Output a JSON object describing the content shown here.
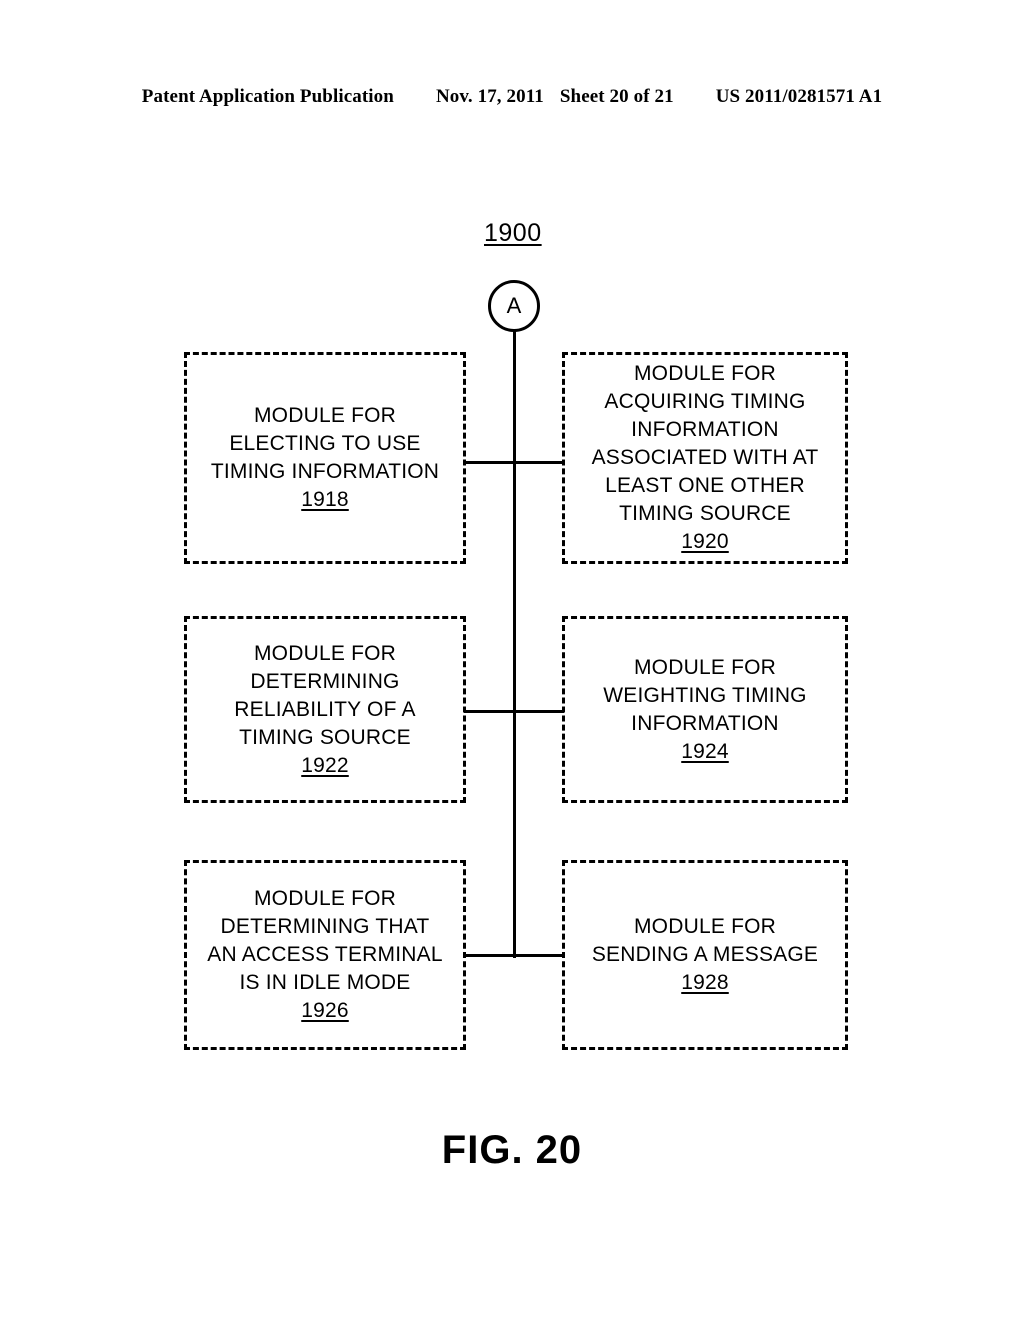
{
  "header": {
    "publication": "Patent Application Publication",
    "date": "Nov. 17, 2011",
    "sheet": "Sheet 20 of 21",
    "document_number": "US 2011/0281571 A1"
  },
  "figure": {
    "reference_number": "1900",
    "connector_node_label": "A",
    "caption": "FIG. 20",
    "line_color": "#000000",
    "background_color": "#ffffff"
  },
  "modules": [
    {
      "id": "1918",
      "side": "left",
      "row": 1,
      "text": "MODULE FOR\nELECTING TO USE\nTIMING INFORMATION",
      "ref": "1918"
    },
    {
      "id": "1920",
      "side": "right",
      "row": 1,
      "text": "MODULE FOR\nACQUIRING TIMING\nINFORMATION\nASSOCIATED WITH AT\nLEAST ONE OTHER\nTIMING SOURCE",
      "ref": "1920"
    },
    {
      "id": "1922",
      "side": "left",
      "row": 2,
      "text": "MODULE FOR\nDETERMINING\nRELIABILITY OF A\nTIMING SOURCE",
      "ref": "1922"
    },
    {
      "id": "1924",
      "side": "right",
      "row": 2,
      "text": "MODULE FOR\nWEIGHTING TIMING\nINFORMATION",
      "ref": "1924"
    },
    {
      "id": "1926",
      "side": "left",
      "row": 3,
      "text": "MODULE FOR\nDETERMINING  THAT\nAN ACCESS TERMINAL\nIS IN IDLE MODE",
      "ref": "1926"
    },
    {
      "id": "1928",
      "side": "right",
      "row": 3,
      "text": "MODULE FOR\nSENDING A MESSAGE",
      "ref": "1928"
    }
  ]
}
